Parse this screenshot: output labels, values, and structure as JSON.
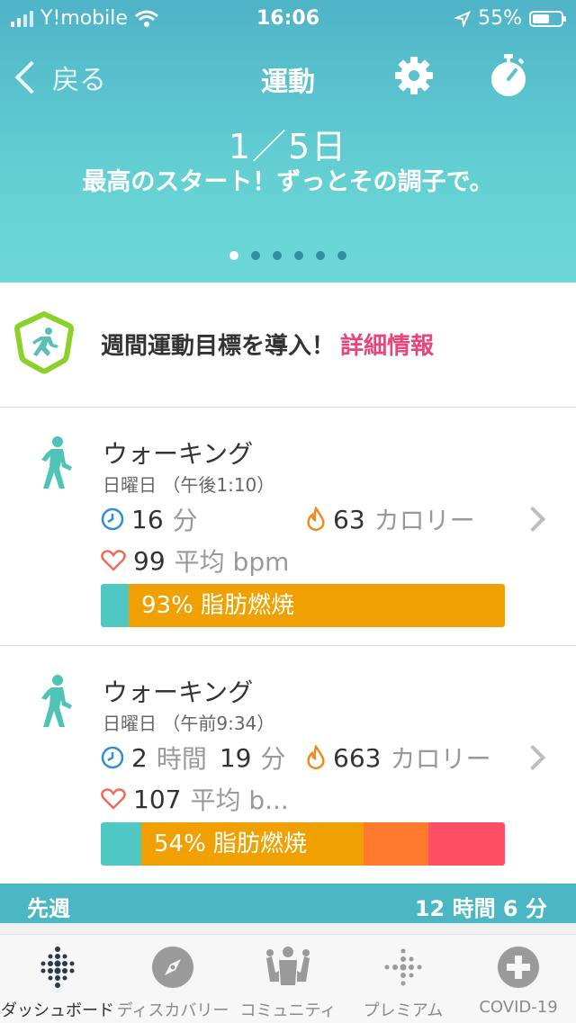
{
  "status": {
    "carrier": "Y!mobile",
    "time": "16:06",
    "battery": "55%"
  },
  "nav": {
    "back_label": "戻る",
    "title": "運動"
  },
  "hero": {
    "day": "1／5日",
    "message": "最高のスタート！ずっとその調子で。",
    "page_count": 6,
    "active_page": 0
  },
  "goal": {
    "text": "週間運動目標を導入！",
    "link": "詳細情報"
  },
  "activities": [
    {
      "name": "ウォーキング",
      "when": "日曜日 （午後1:10）",
      "duration_num1": "16",
      "duration_unit1": "分",
      "duration_num2": "",
      "duration_unit2": "",
      "calories_num": "63",
      "calories_unit": "カロリー",
      "hr_num": "99",
      "hr_unit": "平均 bpm",
      "zone_label": "93% 脂肪燃焼",
      "zones": [
        0.07,
        0.93,
        0,
        0
      ]
    },
    {
      "name": "ウォーキング",
      "when": "日曜日 （午前9:34）",
      "duration_num1": "2",
      "duration_unit1": "時間",
      "duration_num2": "19",
      "duration_unit2": "分",
      "calories_num": "663",
      "calories_unit": "カロリー",
      "hr_num": "107",
      "hr_unit": "平均 b...",
      "zone_label": "54% 脂肪燃焼",
      "zones": [
        0.1,
        0.55,
        0.16,
        0.19
      ]
    }
  ],
  "lastweek": {
    "label": "先週",
    "value": "12 時間 6 分"
  },
  "tabs": [
    "ダッシュボード",
    "ディスカバリー",
    "コミュニティ",
    "プレミアム",
    "COVID-19"
  ],
  "colors": {
    "zone_out": "#4fc8c4",
    "zone_fat": "#f0a000",
    "zone_cardio": "#ff7a2e",
    "zone_peak": "#ff4f64",
    "link": "#e8457a"
  }
}
